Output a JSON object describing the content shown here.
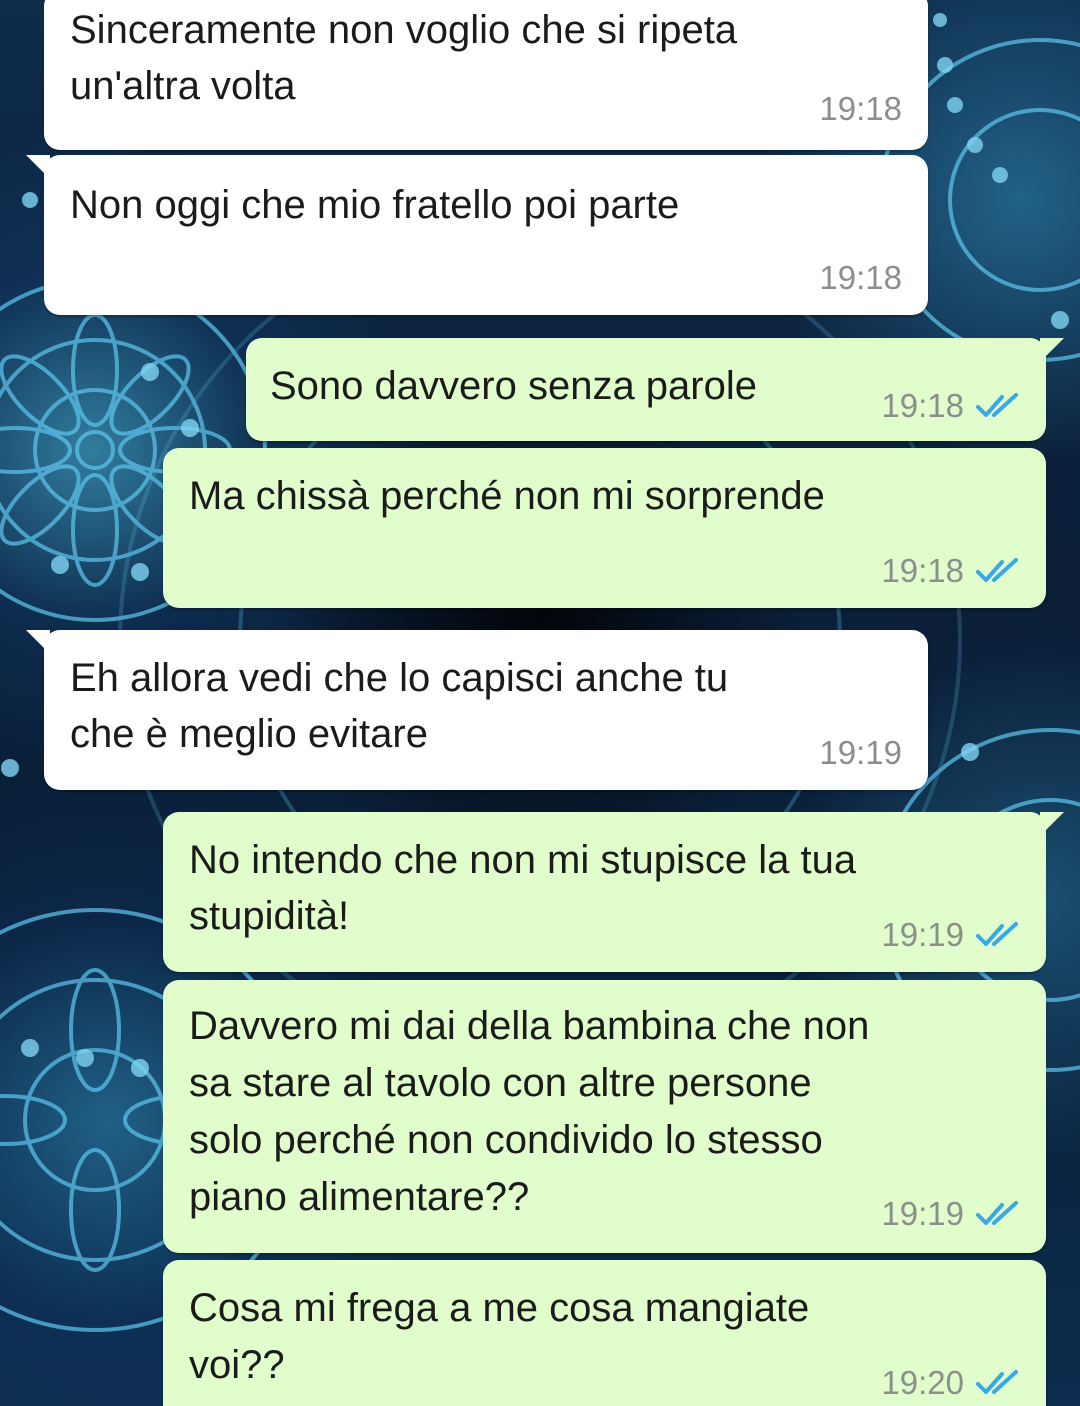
{
  "colors": {
    "incoming_bubble": "#ffffff",
    "outgoing_bubble": "#e2fdcc",
    "timestamp": "#8a8f8c",
    "read_ticks": "#3aa7e6"
  },
  "messages": [
    {
      "direction": "incoming",
      "lines": [
        "Sinceramente non voglio che si ripeta",
        "un'altra volta"
      ],
      "time": "19:18"
    },
    {
      "direction": "incoming",
      "lines": [
        "Non oggi che mio fratello poi parte"
      ],
      "time": "19:18"
    },
    {
      "direction": "outgoing",
      "lines": [
        "Sono davvero senza parole"
      ],
      "time": "19:18",
      "status_icon": "double-check-read-icon"
    },
    {
      "direction": "outgoing",
      "lines": [
        "Ma chissà perché non mi sorprende"
      ],
      "time": "19:18",
      "status_icon": "double-check-read-icon"
    },
    {
      "direction": "incoming",
      "lines": [
        "Eh allora vedi che lo capisci anche tu",
        "che è meglio evitare"
      ],
      "time": "19:19"
    },
    {
      "direction": "outgoing",
      "lines": [
        "No intendo che non mi stupisce la tua",
        "stupidità!"
      ],
      "time": "19:19",
      "status_icon": "double-check-read-icon"
    },
    {
      "direction": "outgoing",
      "lines": [
        "Davvero mi dai della bambina che non",
        "sa stare al tavolo con altre persone",
        "solo perché non condivido lo stesso",
        "piano alimentare??"
      ],
      "time": "19:19",
      "status_icon": "double-check-read-icon"
    },
    {
      "direction": "outgoing",
      "lines": [
        "Cosa mi frega a me cosa mangiate",
        "voi??"
      ],
      "time": "19:20",
      "status_icon": "double-check-read-icon"
    }
  ]
}
